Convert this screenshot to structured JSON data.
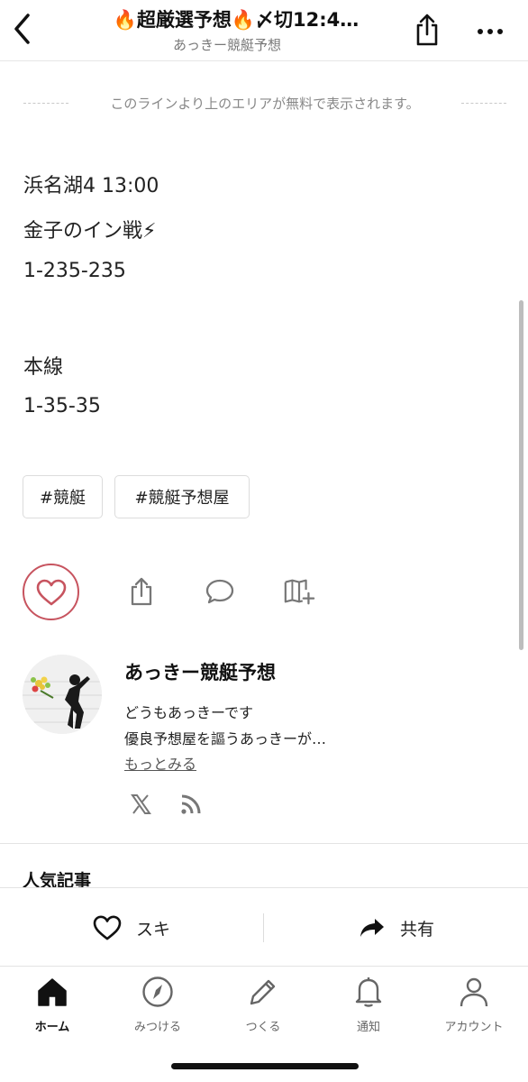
{
  "header": {
    "title": "🔥超厳選予想🔥〆切12:4…",
    "subtitle": "あっきー競艇予想"
  },
  "notice": {
    "free_line_text": "このラインより上のエリアが無料で表示されます。"
  },
  "article": {
    "lines": [
      "浜名湖4 13:00",
      "金子のイン戦⚡",
      "1-235-235",
      "本線",
      "1-35-35"
    ],
    "tags": [
      "#競艇",
      "#競艇予想屋"
    ]
  },
  "author": {
    "name": "あっきー競艇予想",
    "desc_line1": "どうもあっきーです",
    "desc_line2": "優良予想屋を謳うあっきーが…",
    "more_label": "もっとみる"
  },
  "section": {
    "popular_title": "人気記事"
  },
  "bottom_actions": {
    "like_label": "スキ",
    "share_label": "共有"
  },
  "tabs": [
    {
      "label": "ホーム",
      "icon": "home-icon",
      "active": true
    },
    {
      "label": "みつける",
      "icon": "compass-icon"
    },
    {
      "label": "つくる",
      "icon": "pencil-icon"
    },
    {
      "label": "通知",
      "icon": "bell-icon"
    },
    {
      "label": "アカウント",
      "icon": "person-icon"
    }
  ],
  "colors": {
    "like_accent": "#c7545f",
    "text": "#1a1a1a",
    "muted": "#888888"
  }
}
